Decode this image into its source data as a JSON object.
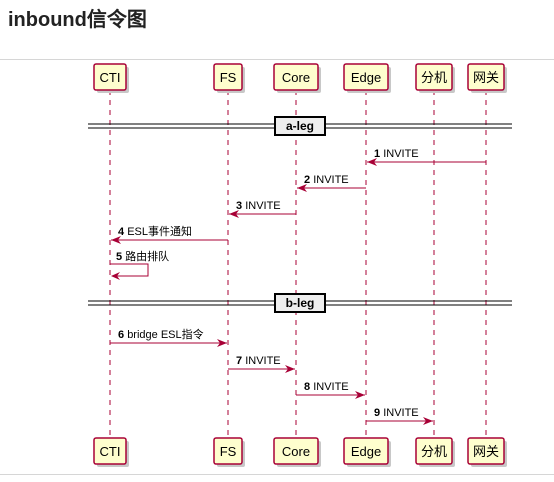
{
  "page": {
    "title": "inbound信令图"
  },
  "diagram": {
    "participants": [
      {
        "id": "cti",
        "label": "CTI"
      },
      {
        "id": "fs",
        "label": "FS"
      },
      {
        "id": "core",
        "label": "Core"
      },
      {
        "id": "edge",
        "label": "Edge"
      },
      {
        "id": "ext",
        "label": "分机"
      },
      {
        "id": "gw",
        "label": "网关"
      }
    ],
    "dividers": [
      {
        "label": "a-leg"
      },
      {
        "label": "b-leg"
      }
    ],
    "messages": [
      {
        "num": "1",
        "text": "INVITE",
        "from": "gw",
        "to": "edge"
      },
      {
        "num": "2",
        "text": "INVITE",
        "from": "edge",
        "to": "core"
      },
      {
        "num": "3",
        "text": "INVITE",
        "from": "core",
        "to": "fs"
      },
      {
        "num": "4",
        "text": "ESL事件通知",
        "from": "fs",
        "to": "cti"
      },
      {
        "num": "5",
        "text": "路由排队",
        "from": "cti",
        "to": "cti"
      },
      {
        "num": "6",
        "text": "bridge ESL指令",
        "from": "cti",
        "to": "fs"
      },
      {
        "num": "7",
        "text": "INVITE",
        "from": "fs",
        "to": "core"
      },
      {
        "num": "8",
        "text": "INVITE",
        "from": "core",
        "to": "edge"
      },
      {
        "num": "9",
        "text": "INVITE",
        "from": "edge",
        "to": "ext"
      }
    ],
    "colors": {
      "box_fill": "#FEFECE",
      "line": "#A80036",
      "divider_fill": "#EEEEEE"
    }
  }
}
